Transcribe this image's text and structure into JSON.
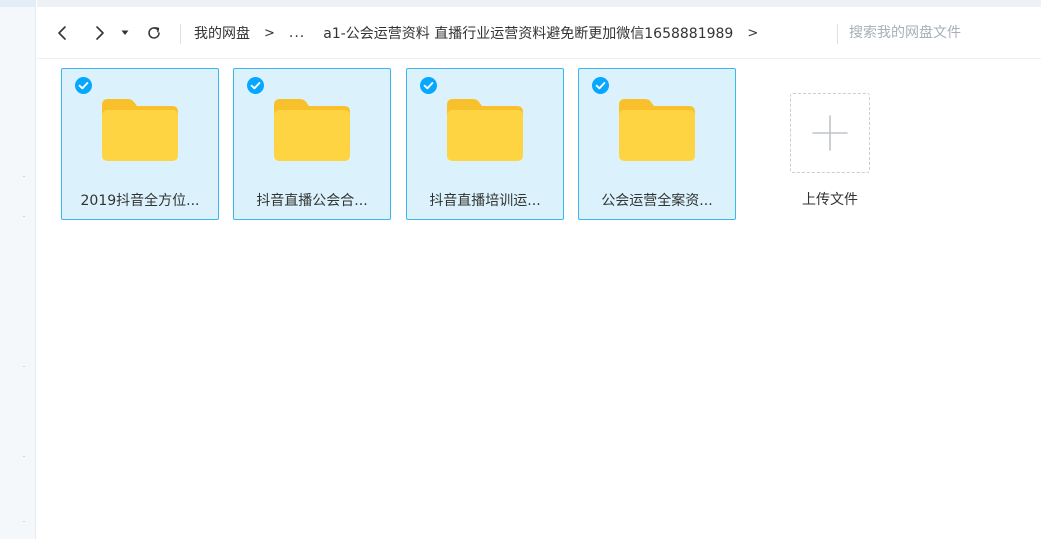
{
  "nav": {
    "back_icon": "chevron-left-icon",
    "forward_icon": "chevron-right-icon",
    "history_icon": "caret-down-icon",
    "refresh_icon": "refresh-icon"
  },
  "breadcrumb": {
    "root": "我的网盘",
    "separator": ">",
    "ellipsis": "...",
    "current": "a1-公会运营资料 直播行业运营资料避免断更加微信1658881989",
    "trailing_separator": ">"
  },
  "search": {
    "placeholder": "搜索我的网盘文件",
    "value": ""
  },
  "files": [
    {
      "name": "2019抖音全方位...",
      "selected": true,
      "type": "folder"
    },
    {
      "name": "抖音直播公会合...",
      "selected": true,
      "type": "folder"
    },
    {
      "name": "抖音直播培训运...",
      "selected": true,
      "type": "folder"
    },
    {
      "name": "公会运营全案资...",
      "selected": true,
      "type": "folder"
    }
  ],
  "upload": {
    "label": "上传文件",
    "icon": "plus-icon"
  },
  "colors": {
    "selected_bg": "#dbf2fd",
    "selected_border": "#3bb6ee",
    "check": "#06a7ff",
    "folder": "#ffd443",
    "folder_tab": "#f8c12c"
  }
}
